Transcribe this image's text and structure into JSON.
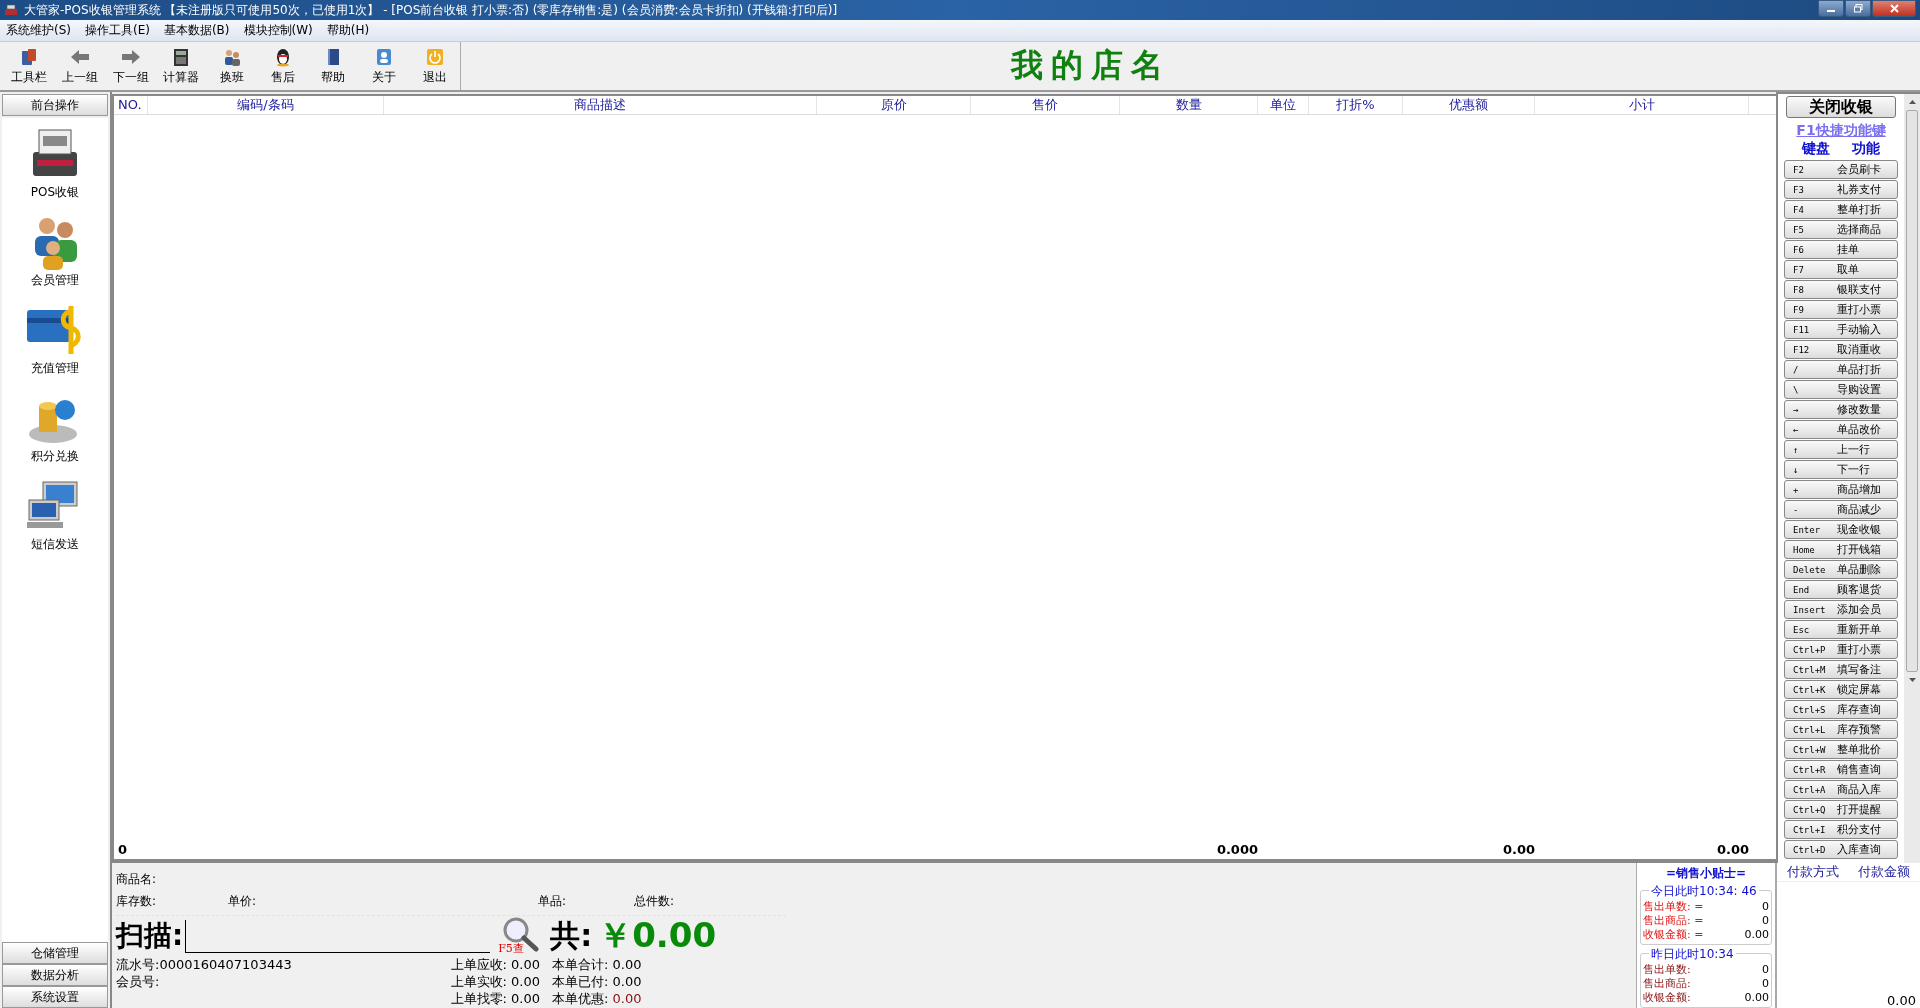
{
  "window": {
    "title": "大管家-POS收银管理系统 【未注册版只可使用50次，已使用1次】 - [POS前台收银 打小票:否) (零库存销售:是) (会员消费:会员卡折扣) (开钱箱:打印后)]"
  },
  "menu": [
    "系统维护(S)",
    "操作工具(E)",
    "基本数据(B)",
    "模块控制(W)",
    "帮助(H)"
  ],
  "toolbar": [
    "工具栏",
    "上一组",
    "下一组",
    "计算器",
    "换班",
    "售后",
    "帮助",
    "关于",
    "退出"
  ],
  "store_name": "我的店名",
  "sidebar": {
    "header": "前台操作",
    "items": [
      {
        "label": "POS收银"
      },
      {
        "label": "会员管理"
      },
      {
        "label": "充值管理"
      },
      {
        "label": "积分兑换"
      },
      {
        "label": "短信发送"
      }
    ],
    "bottom": [
      "仓储管理",
      "数据分析",
      "系统设置"
    ]
  },
  "table": {
    "columns": [
      "NO.",
      "编码/条码",
      "商品描述",
      "原价",
      "售价",
      "数量",
      "单位",
      "打折%",
      "优惠额",
      "小计"
    ],
    "totals": {
      "count": "0",
      "quantity": "0.000",
      "discount": "0.00",
      "subtotal": "0.00"
    }
  },
  "info": {
    "product_name": "商品名:",
    "stock": "库存数:",
    "unit_price": "单价:",
    "single": "单品:",
    "total_pieces": "总件数:",
    "scan_label": "扫描:",
    "lookup": "F5查",
    "total_label": "共:",
    "total_amount": "￥0.00",
    "left": [
      {
        "label": "流水号:",
        "value": "0000160407103443"
      },
      {
        "label": "会员号:"
      }
    ],
    "middle": [
      {
        "label": "上单应收:",
        "value": "0.00"
      },
      {
        "label": "上单实收:",
        "value": "0.00"
      },
      {
        "label": "上单找零:",
        "value": "0.00"
      }
    ],
    "right": [
      {
        "label": "本单合计:",
        "value": "0.00",
        "highlight": false
      },
      {
        "label": "本单已付:",
        "value": "0.00",
        "highlight": false
      },
      {
        "label": "本单优惠:",
        "value": "0.00",
        "highlight": true
      }
    ]
  },
  "tips": {
    "title": "=销售小贴士=",
    "groups": [
      {
        "legend": "今日此时10:34: 46",
        "today": true,
        "rows": [
          {
            "label": "售出单数: =",
            "value": "0"
          },
          {
            "label": "售出商品: =",
            "value": "0"
          },
          {
            "label": "收银金额: =",
            "value": "0.00"
          }
        ]
      },
      {
        "legend": "昨日此时10:34",
        "today": false,
        "rows": [
          {
            "label": "售出单数:",
            "value": "0"
          },
          {
            "label": "售出商品:",
            "value": "0"
          },
          {
            "label": "收银金额:",
            "value": "0.00"
          }
        ]
      }
    ]
  },
  "payments": {
    "columns": [
      "付款方式",
      "付款金额"
    ],
    "total": "0.00"
  },
  "shortcuts": {
    "close_button": "关闭收银",
    "link": "F1快捷功能键",
    "col_key": "键盘",
    "col_function": "功能",
    "keys": [
      {
        "key": "F2",
        "label": "会员刷卡"
      },
      {
        "key": "F3",
        "label": "礼券支付"
      },
      {
        "key": "F4",
        "label": "整单打折"
      },
      {
        "key": "F5",
        "label": "选择商品"
      },
      {
        "key": "F6",
        "label": "挂单"
      },
      {
        "key": "F7",
        "label": "取单"
      },
      {
        "key": "F8",
        "label": "银联支付"
      },
      {
        "key": "F9",
        "label": "重打小票"
      },
      {
        "key": "F11",
        "label": "手动输入"
      },
      {
        "key": "F12",
        "label": "取消重收"
      },
      {
        "key": "/",
        "label": "单品打折"
      },
      {
        "key": "\\",
        "label": "导购设置"
      },
      {
        "key": "→",
        "label": "修改数量"
      },
      {
        "key": "←",
        "label": "单品改价"
      },
      {
        "key": "↑",
        "label": "上一行"
      },
      {
        "key": "↓",
        "label": "下一行"
      },
      {
        "key": "+",
        "label": "商品增加"
      },
      {
        "key": "-",
        "label": "商品减少"
      },
      {
        "key": "Enter",
        "label": "现金收银"
      },
      {
        "key": "Home",
        "label": "打开钱箱"
      },
      {
        "key": "Delete",
        "label": "单品删除"
      },
      {
        "key": "End",
        "label": "顾客退货"
      },
      {
        "key": "Insert",
        "label": "添加会员"
      },
      {
        "key": "Esc",
        "label": "重新开单"
      },
      {
        "key": "Ctrl+P",
        "label": "重打小票"
      },
      {
        "key": "Ctrl+M",
        "label": "填写备注"
      },
      {
        "key": "Ctrl+K",
        "label": "锁定屏幕"
      },
      {
        "key": "Ctrl+S",
        "label": "库存查询"
      },
      {
        "key": "Ctrl+L",
        "label": "库存预警"
      },
      {
        "key": "Ctrl+W",
        "label": "整单批价"
      },
      {
        "key": "Ctrl+R",
        "label": "销售查询"
      },
      {
        "key": "Ctrl+A",
        "label": "商品入库"
      },
      {
        "key": "Ctrl+Q",
        "label": "打开提醒"
      },
      {
        "key": "Ctrl+I",
        "label": "积分支付"
      },
      {
        "key": "Ctrl+D",
        "label": "入库查询"
      }
    ]
  }
}
